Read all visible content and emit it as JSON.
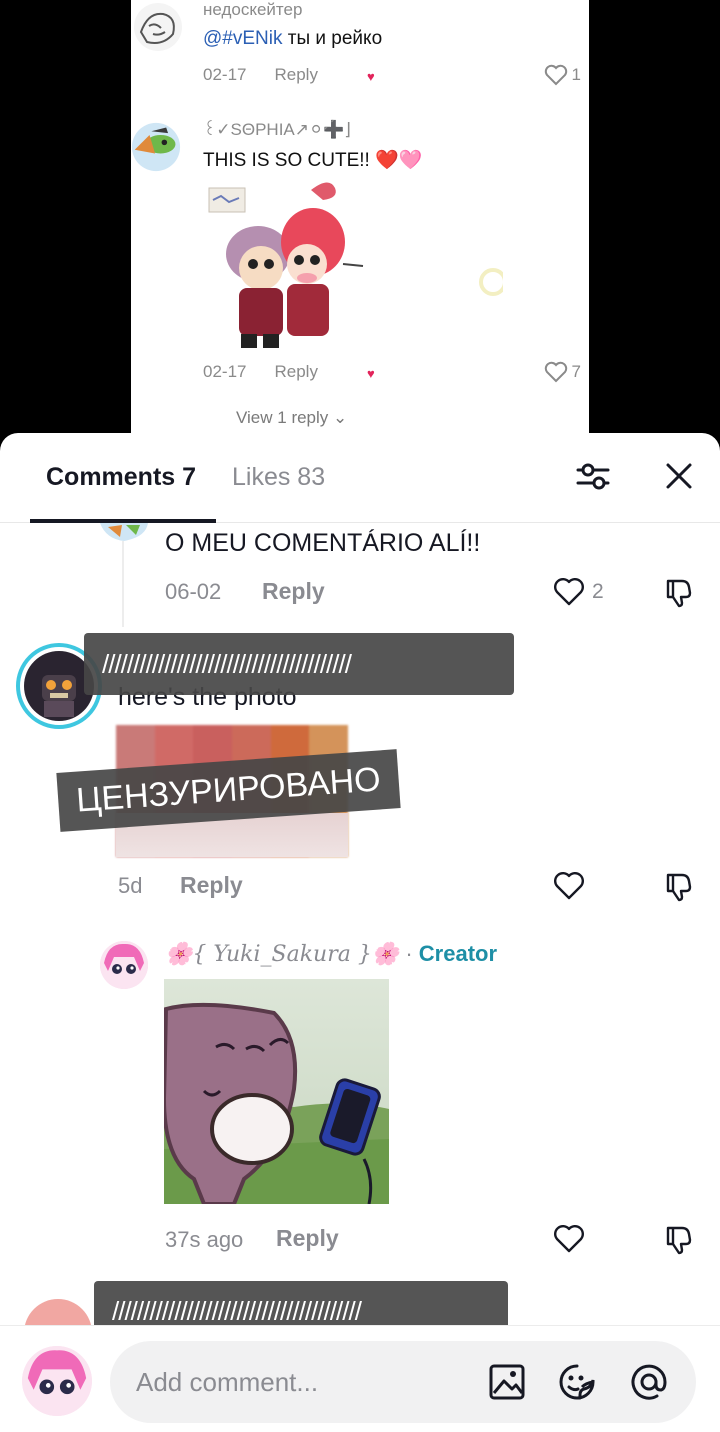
{
  "video_comments": [
    {
      "username": "недоскейтер",
      "mention": "@#vENik",
      "text": " ты и рейко",
      "date": "02-17",
      "reply_label": "Reply",
      "likes": "1"
    },
    {
      "username": "꒰✓SΘPHIA↗⚪➕⌋",
      "text": "THIS IS SO CUTE!! ❤️🩷",
      "date": "02-17",
      "reply_label": "Reply",
      "likes": "7"
    }
  ],
  "view_replies": "View 1 reply ⌄",
  "tabs": {
    "comments": "Comments 7",
    "likes": "Likes 83"
  },
  "comments": [
    {
      "text": "O MEU COMENTÁRIO ALÍ!!",
      "date": "06-02",
      "reply_label": "Reply",
      "likes": "2"
    },
    {
      "censor_bar": "////////////////////////////////////////",
      "text": "here's the photo",
      "censor_label": "ЦЕНЗУРИРОВАНО",
      "date": "5d",
      "reply_label": "Reply"
    },
    {
      "username": "🌸{ Yuki_Sakura }🌸",
      "separator": " · ",
      "badge": "Creator",
      "date": "37s ago",
      "reply_label": "Reply"
    },
    {
      "censor_bar": "////////////////////////////////////////"
    }
  ],
  "input": {
    "placeholder": "Add comment..."
  },
  "colors": {
    "accent_creator": "#1e8fa6",
    "like_heart": "#e2245b",
    "text_primary": "#161823",
    "text_secondary": "#8a8b91"
  }
}
